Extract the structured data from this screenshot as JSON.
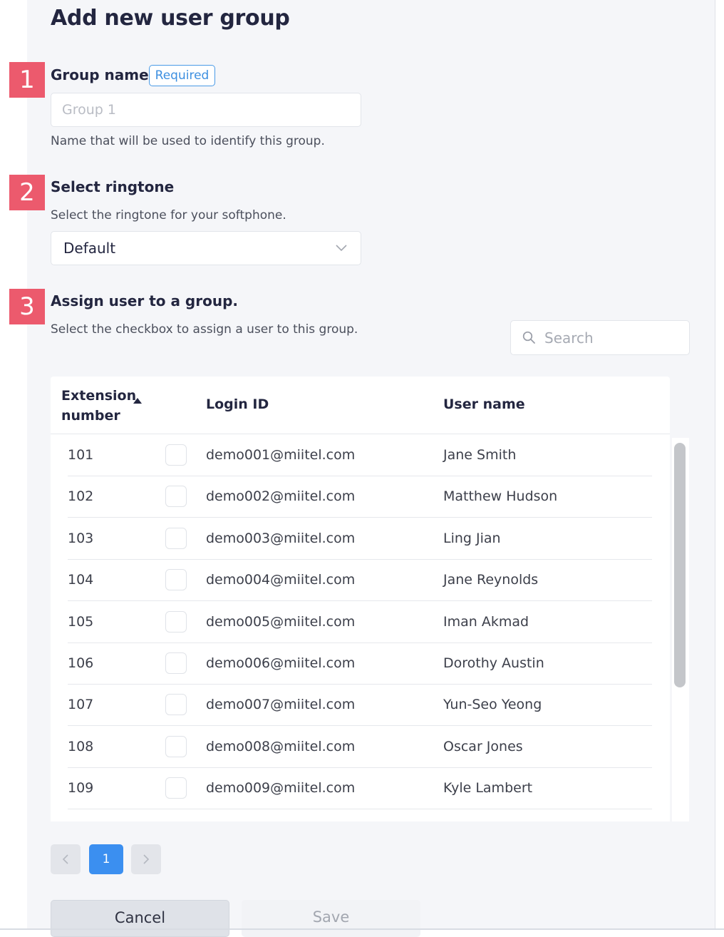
{
  "page": {
    "title": "Add new user group"
  },
  "steps": [
    "1",
    "2",
    "3"
  ],
  "group_name": {
    "title": "Group name",
    "required_label": "Required",
    "placeholder": "Group 1",
    "value": "",
    "help": "Name that will be used to identify this group."
  },
  "ringtone": {
    "title": "Select ringtone",
    "help": "Select the ringtone for your softphone.",
    "selected": "Default"
  },
  "assign": {
    "title": "Assign user to a group.",
    "help": "Select the checkbox to assign a user to this group.",
    "search_placeholder": "Search"
  },
  "table": {
    "columns": {
      "extension": "Extension number",
      "login": "Login ID",
      "user": "User name"
    },
    "sort": {
      "column": "extension",
      "direction": "ascending"
    },
    "rows": [
      {
        "ext": "101",
        "login": "demo001@miitel.com",
        "user": "Jane Smith",
        "checked": false
      },
      {
        "ext": "102",
        "login": "demo002@miitel.com",
        "user": "Matthew Hudson",
        "checked": false
      },
      {
        "ext": "103",
        "login": "demo003@miitel.com",
        "user": "Ling Jian",
        "checked": false
      },
      {
        "ext": "104",
        "login": "demo004@miitel.com",
        "user": "Jane Reynolds",
        "checked": false
      },
      {
        "ext": "105",
        "login": "demo005@miitel.com",
        "user": "Iman Akmad",
        "checked": false
      },
      {
        "ext": "106",
        "login": "demo006@miitel.com",
        "user": "Dorothy Austin",
        "checked": false
      },
      {
        "ext": "107",
        "login": "demo007@miitel.com",
        "user": "Yun-Seo Yeong",
        "checked": false
      },
      {
        "ext": "108",
        "login": "demo008@miitel.com",
        "user": "Oscar Jones",
        "checked": false
      },
      {
        "ext": "109",
        "login": "demo009@miitel.com",
        "user": "Kyle Lambert",
        "checked": false
      }
    ]
  },
  "pagination": {
    "current": "1"
  },
  "actions": {
    "cancel": "Cancel",
    "save": "Save"
  },
  "colors": {
    "step_badge": "#ec5a6d",
    "accent": "#3b8ff0",
    "required_border": "#4a9ae6",
    "heading": "#232640"
  },
  "icons": {
    "select": "chevron-down-icon",
    "search": "search-icon",
    "sort": "sort-ascending-icon",
    "prev": "chevron-left-icon",
    "next": "chevron-right-icon"
  }
}
